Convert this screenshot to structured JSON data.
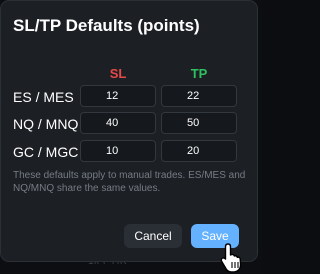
{
  "background": {
    "label": "1k PTIK"
  },
  "dialog": {
    "title": "SL/TP Defaults (points)",
    "columns": {
      "sl": {
        "label": "SL",
        "color": "#e64a47"
      },
      "tp": {
        "label": "TP",
        "color": "#2fc060"
      }
    },
    "rows": [
      {
        "label": "ES / MES",
        "sl": "12",
        "tp": "22"
      },
      {
        "label": "NQ / MNQ",
        "sl": "40",
        "tp": "50"
      },
      {
        "label": "GC / MGC",
        "sl": "10",
        "tp": "20"
      }
    ],
    "note": "These defaults apply to manual trades. ES/MES and NQ/MNQ share the same values.",
    "buttons": {
      "cancel": "Cancel",
      "save": "Save"
    }
  },
  "colors": {
    "accent": "#63b1ff",
    "surface": "#1c1f24",
    "input_bg": "#15181c"
  },
  "icons": {
    "pointer": "hand-pointer-icon"
  }
}
